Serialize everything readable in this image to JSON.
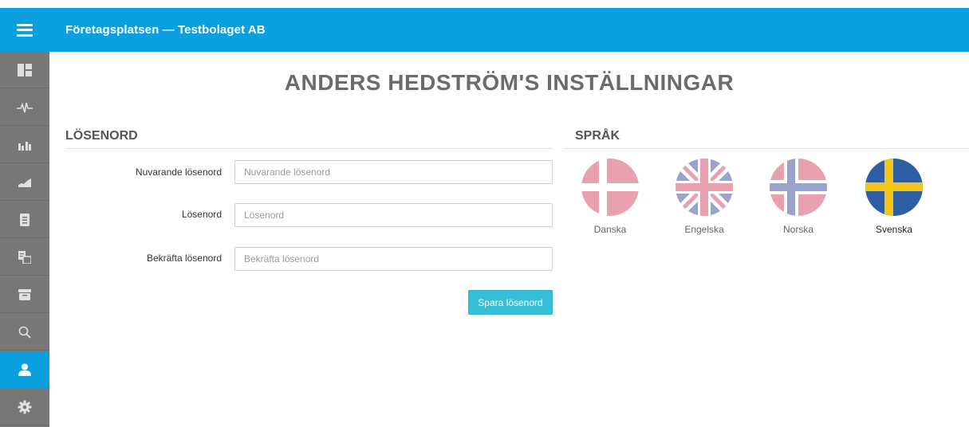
{
  "app": {
    "title": "Företagsplatsen — Testbolaget AB"
  },
  "page": {
    "title": "ANDERS HEDSTRÖM'S INSTÄLLNINGAR"
  },
  "password": {
    "heading": "LÖSENORD",
    "fields": [
      {
        "label": "Nuvarande lösenord",
        "placeholder": "Nuvarande lösenord",
        "value": ""
      },
      {
        "label": "Lösenord",
        "placeholder": "Lösenord",
        "value": ""
      },
      {
        "label": "Bekräfta lösenord",
        "placeholder": "Bekräfta lösenord",
        "value": ""
      }
    ],
    "save_label": "Spara lösenord"
  },
  "language": {
    "heading": "SPRÅK",
    "options": [
      {
        "label": "Danska",
        "flag": "denmark-flag-icon",
        "selected": false
      },
      {
        "label": "Engelska",
        "flag": "uk-flag-icon",
        "selected": false
      },
      {
        "label": "Norska",
        "flag": "norway-flag-icon",
        "selected": false
      },
      {
        "label": "Svenska",
        "flag": "sweden-flag-icon",
        "selected": true
      }
    ]
  },
  "sidebar": {
    "items": [
      {
        "icon": "dashboard-icon",
        "active": false
      },
      {
        "icon": "activity-pulse-icon",
        "active": false
      },
      {
        "icon": "bar-chart-icon",
        "active": false
      },
      {
        "icon": "area-chart-icon",
        "active": false
      },
      {
        "icon": "document-icon",
        "active": false
      },
      {
        "icon": "invoice-icon",
        "active": false
      },
      {
        "icon": "archive-icon",
        "active": false
      },
      {
        "icon": "search-icon",
        "active": false
      },
      {
        "icon": "user-icon",
        "active": true
      },
      {
        "icon": "settings-gear-icon",
        "active": false
      }
    ]
  },
  "colors": {
    "brand": "#0a9fde",
    "sidebar": "#777777",
    "button": "#34bfd6",
    "heading": "#6b6b6b"
  }
}
